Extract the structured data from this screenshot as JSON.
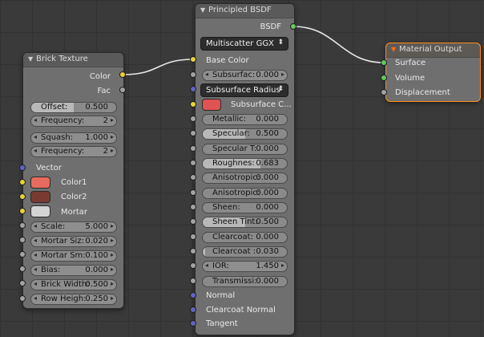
{
  "colors": {
    "color1": "#e66a5e",
    "color2": "#7a3a32",
    "mortar": "#d4d4d4",
    "subsurface_color": "#e05353",
    "link": "#e8e8e8"
  },
  "brick": {
    "title": "Brick Texture",
    "outputs": [
      "Color",
      "Fac"
    ],
    "offset": {
      "label": "Offset:",
      "value": "0.500",
      "fraction": 0.5
    },
    "frequency1": {
      "label": "Frequency:",
      "value": "2"
    },
    "squash": {
      "label": "Squash:",
      "value": "1.000"
    },
    "frequency2": {
      "label": "Frequency:",
      "value": "2"
    },
    "vector_label": "Vector",
    "color1_label": "Color1",
    "color2_label": "Color2",
    "mortar_label": "Mortar",
    "params": [
      {
        "label": "Scale:",
        "value": "5.000"
      },
      {
        "label": "Mortar Siz:",
        "value": "0.020"
      },
      {
        "label": "Mortar Sm:",
        "value": "0.100"
      },
      {
        "label": "Bias:",
        "value": "0.000"
      },
      {
        "label": "Brick Width:",
        "value": "0.500"
      },
      {
        "label": "Row Heigh:",
        "value": "0.250"
      }
    ]
  },
  "bsdf": {
    "title": "Principled BSDF",
    "output": "BSDF",
    "distribution": "Multiscatter GGX",
    "base_color": "Base Color",
    "subsurface": {
      "label": "Subsurfac:",
      "value": "0.000"
    },
    "subsurface_method": "Subsurface Radius",
    "subsurface_color": "Subsurface C...",
    "sliders": [
      {
        "label": "Metallic:",
        "value": "0.000",
        "fraction": 0.0
      },
      {
        "label": "Specular:",
        "value": "0.500",
        "fraction": 0.5
      },
      {
        "label": "Specular T:",
        "value": "0.000",
        "fraction": 0.0
      },
      {
        "label": "Roughnes:",
        "value": "0.683",
        "fraction": 0.683
      },
      {
        "label": "Anisotropic:",
        "value": "0.000",
        "fraction": 0.0
      },
      {
        "label": "Anisotropic:",
        "value": "0.000",
        "fraction": 0.0
      },
      {
        "label": "Sheen:",
        "value": "0.000",
        "fraction": 0.0
      },
      {
        "label": "Sheen Tint:",
        "value": "0.500",
        "fraction": 0.5
      },
      {
        "label": "Clearcoat:",
        "value": "0.000",
        "fraction": 0.0
      },
      {
        "label": "Clearcoat :",
        "value": "0.030",
        "fraction": 0.03
      }
    ],
    "ior": {
      "label": "IOR:",
      "value": "1.450"
    },
    "transmission": {
      "label": "Transmissi:",
      "value": "0.000",
      "fraction": 0.0
    },
    "inputs_bottom": [
      "Normal",
      "Clearcoat Normal",
      "Tangent"
    ]
  },
  "output": {
    "title": "Material Output",
    "inputs": [
      "Surface",
      "Volume",
      "Displacement"
    ]
  }
}
